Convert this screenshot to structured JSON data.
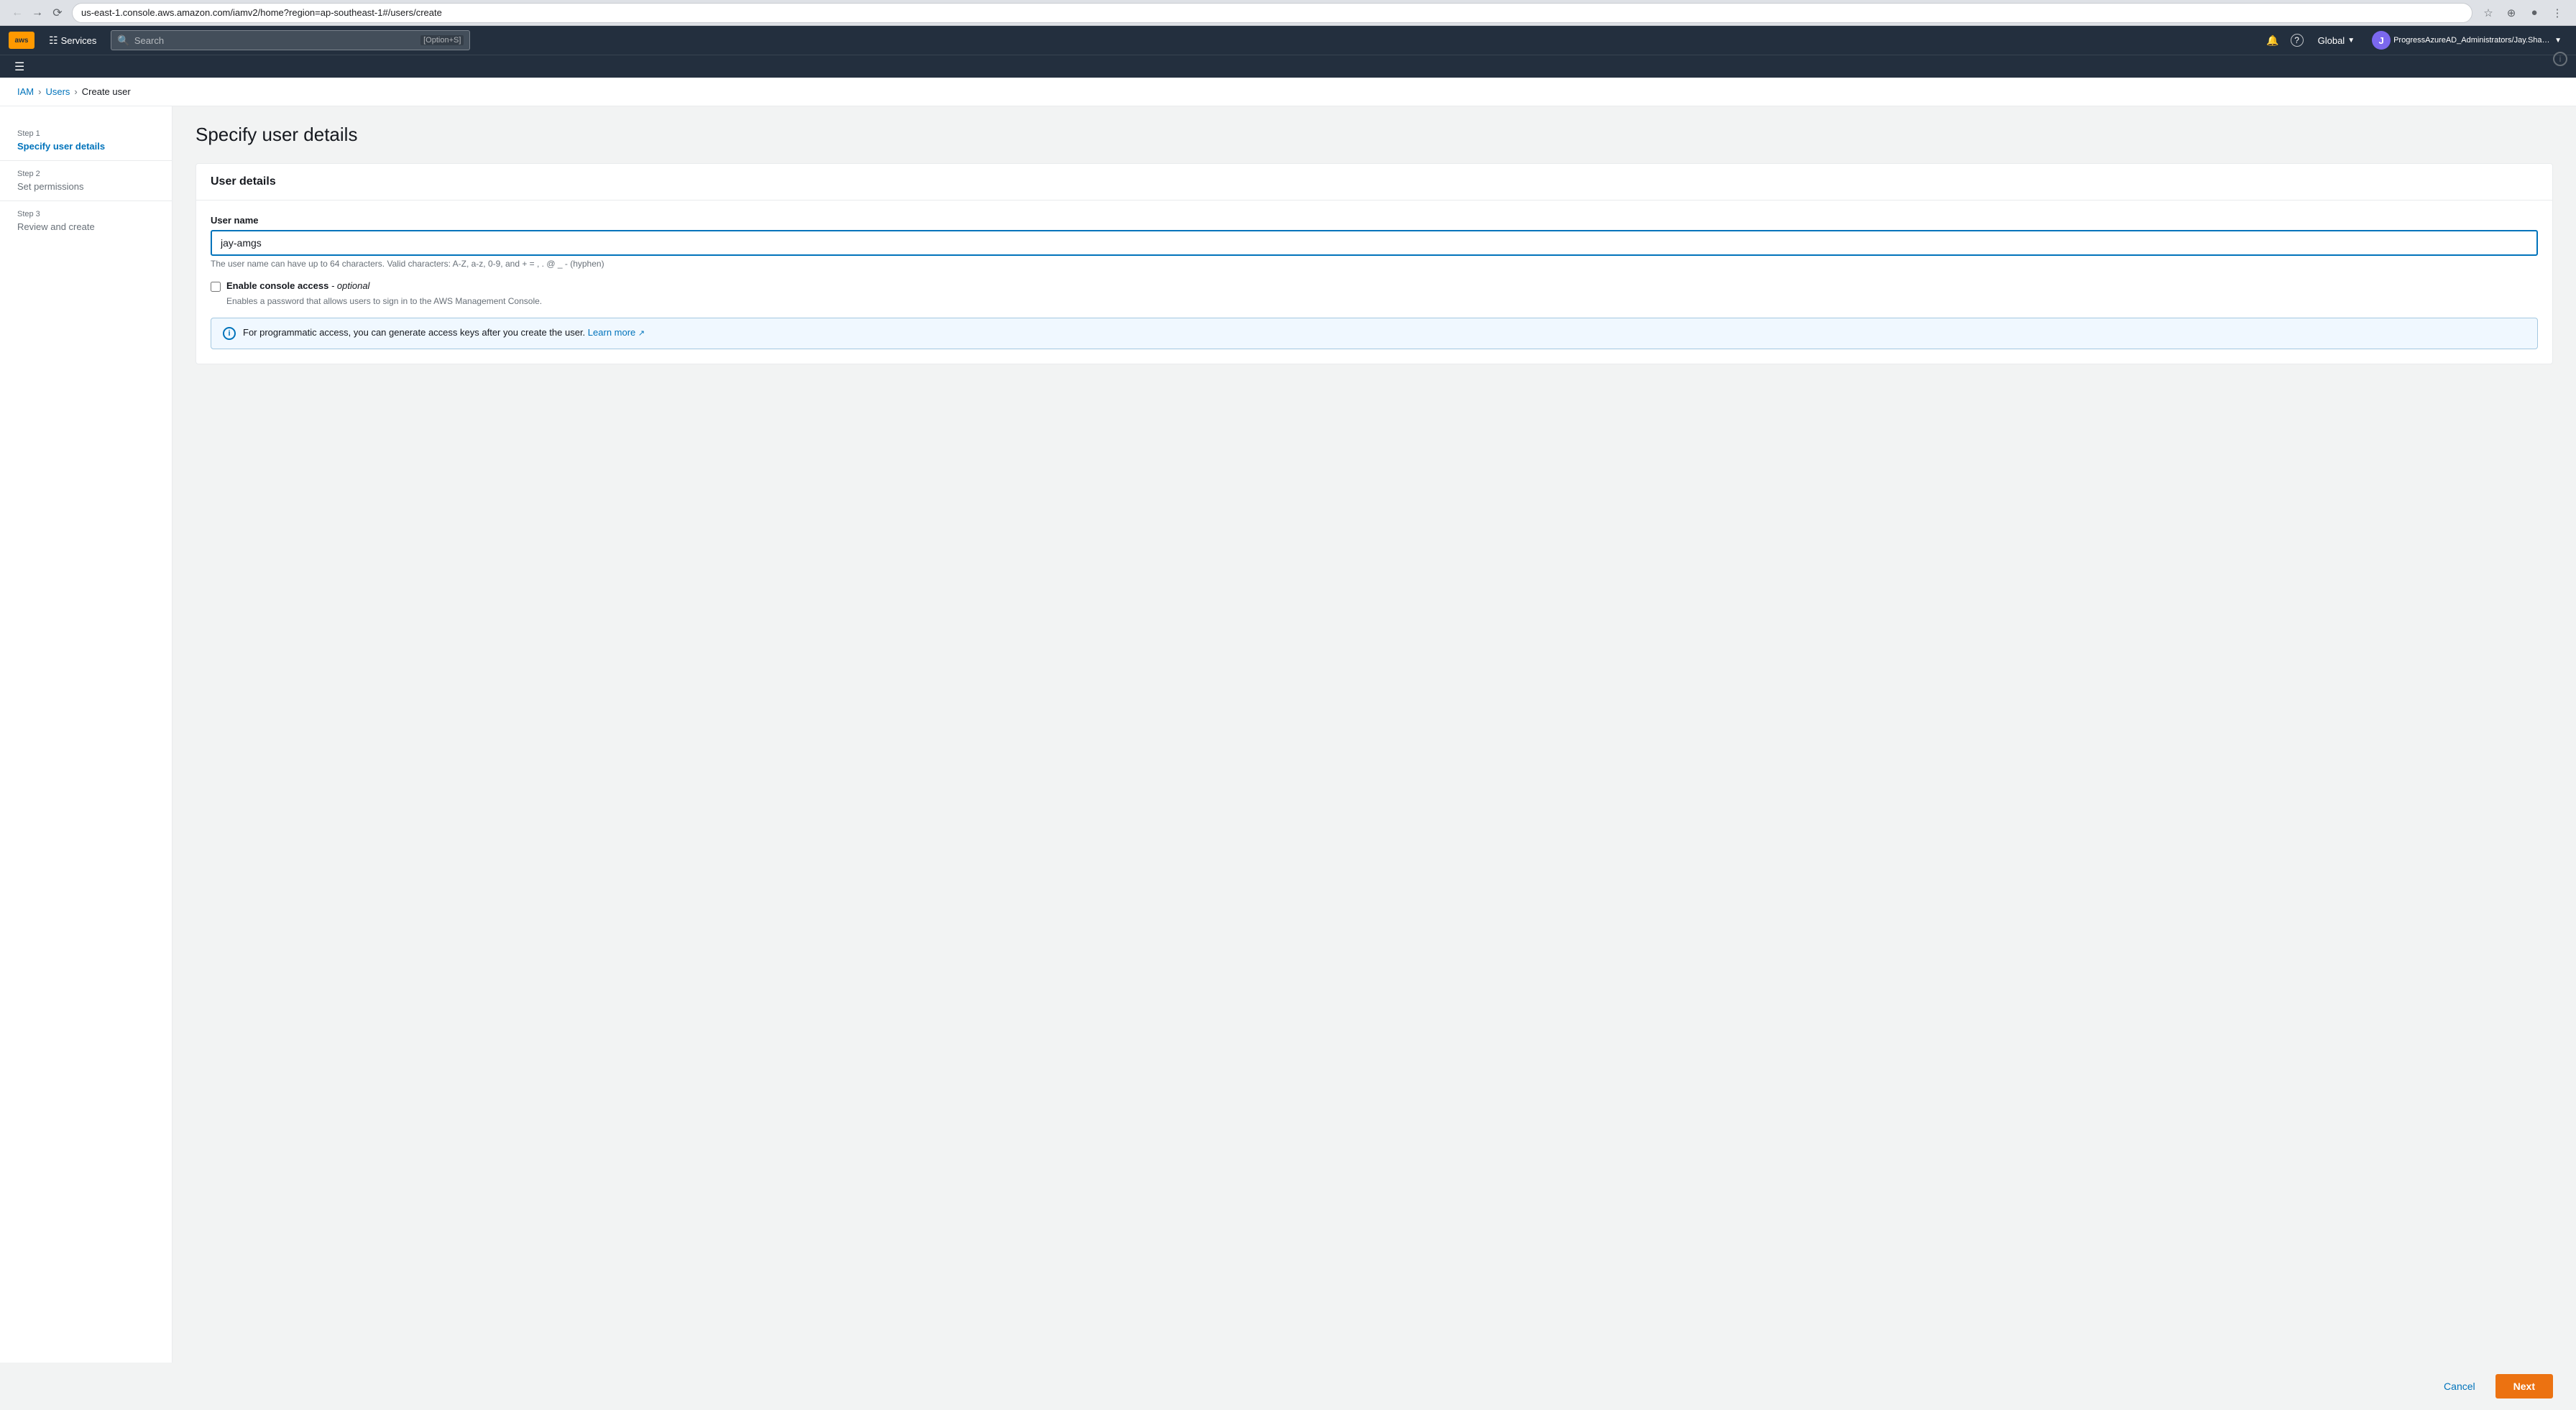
{
  "browser": {
    "url": "us-east-1.console.aws.amazon.com/iamv2/home?region=ap-southeast-1#/users/create",
    "back_title": "Back",
    "forward_title": "Forward",
    "refresh_title": "Refresh"
  },
  "topnav": {
    "services_label": "Services",
    "search_placeholder": "Search",
    "search_shortcut": "[Option+S]",
    "region_label": "Global",
    "account_label": "ProgressAzureAD_Administrators/Jay.Sharma@progress.com @ chef...",
    "user_initial": "J",
    "bell_icon": "🔔",
    "help_icon": "?",
    "grid_icon": "⊞"
  },
  "breadcrumb": {
    "items": [
      "IAM",
      "Users",
      "Create user"
    ]
  },
  "sidebar": {
    "steps": [
      {
        "number": "Step 1",
        "title": "Specify user details",
        "state": "active"
      },
      {
        "number": "Step 2",
        "title": "Set permissions",
        "state": "inactive"
      },
      {
        "number": "Step 3",
        "title": "Review and create",
        "state": "inactive"
      }
    ]
  },
  "page": {
    "title": "Specify user details",
    "card_title": "User details",
    "username_label": "User name",
    "username_value": "jay-amgs",
    "username_hint": "The user name can have up to 64 characters. Valid characters: A-Z, a-z, 0-9, and + = , . @ _ - (hyphen)",
    "console_access_label": "Enable console access",
    "console_access_optional": " - optional",
    "console_access_description": "Enables a password that allows users to sign in to the AWS Management Console.",
    "info_text": "For programmatic access, you can generate access keys after you create the user.",
    "learn_more_label": "Learn more",
    "cancel_label": "Cancel",
    "next_label": "Next"
  }
}
